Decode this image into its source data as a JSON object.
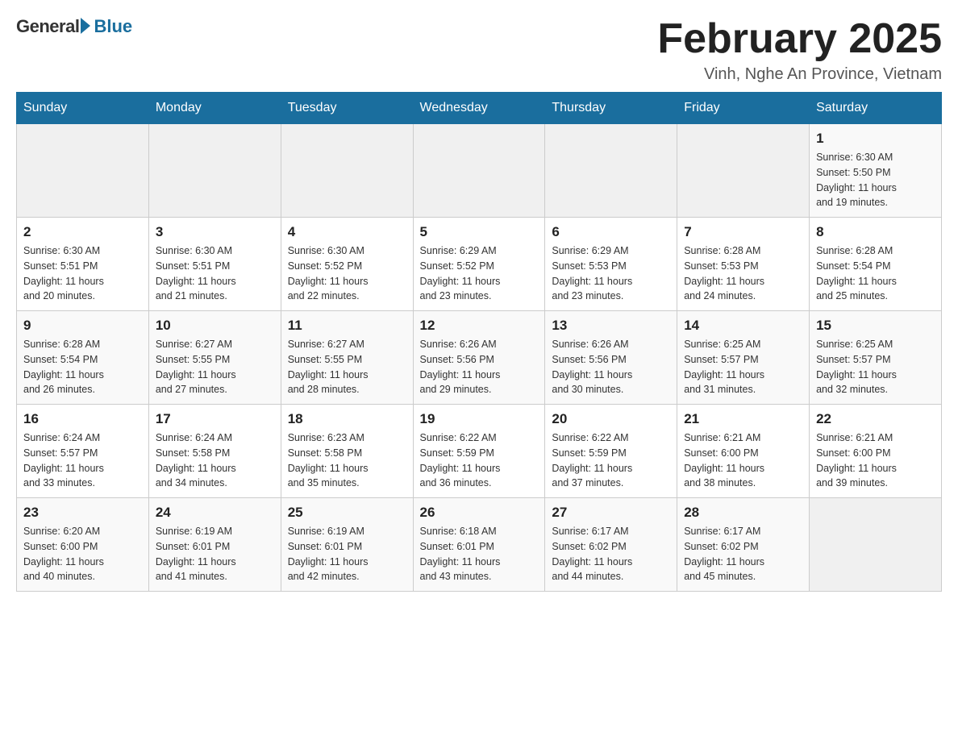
{
  "logo": {
    "general": "General",
    "blue": "Blue",
    "subtitle": ""
  },
  "header": {
    "title": "February 2025",
    "location": "Vinh, Nghe An Province, Vietnam"
  },
  "days_of_week": [
    "Sunday",
    "Monday",
    "Tuesday",
    "Wednesday",
    "Thursday",
    "Friday",
    "Saturday"
  ],
  "weeks": [
    [
      {
        "day": "",
        "info": ""
      },
      {
        "day": "",
        "info": ""
      },
      {
        "day": "",
        "info": ""
      },
      {
        "day": "",
        "info": ""
      },
      {
        "day": "",
        "info": ""
      },
      {
        "day": "",
        "info": ""
      },
      {
        "day": "1",
        "info": "Sunrise: 6:30 AM\nSunset: 5:50 PM\nDaylight: 11 hours\nand 19 minutes."
      }
    ],
    [
      {
        "day": "2",
        "info": "Sunrise: 6:30 AM\nSunset: 5:51 PM\nDaylight: 11 hours\nand 20 minutes."
      },
      {
        "day": "3",
        "info": "Sunrise: 6:30 AM\nSunset: 5:51 PM\nDaylight: 11 hours\nand 21 minutes."
      },
      {
        "day": "4",
        "info": "Sunrise: 6:30 AM\nSunset: 5:52 PM\nDaylight: 11 hours\nand 22 minutes."
      },
      {
        "day": "5",
        "info": "Sunrise: 6:29 AM\nSunset: 5:52 PM\nDaylight: 11 hours\nand 23 minutes."
      },
      {
        "day": "6",
        "info": "Sunrise: 6:29 AM\nSunset: 5:53 PM\nDaylight: 11 hours\nand 23 minutes."
      },
      {
        "day": "7",
        "info": "Sunrise: 6:28 AM\nSunset: 5:53 PM\nDaylight: 11 hours\nand 24 minutes."
      },
      {
        "day": "8",
        "info": "Sunrise: 6:28 AM\nSunset: 5:54 PM\nDaylight: 11 hours\nand 25 minutes."
      }
    ],
    [
      {
        "day": "9",
        "info": "Sunrise: 6:28 AM\nSunset: 5:54 PM\nDaylight: 11 hours\nand 26 minutes."
      },
      {
        "day": "10",
        "info": "Sunrise: 6:27 AM\nSunset: 5:55 PM\nDaylight: 11 hours\nand 27 minutes."
      },
      {
        "day": "11",
        "info": "Sunrise: 6:27 AM\nSunset: 5:55 PM\nDaylight: 11 hours\nand 28 minutes."
      },
      {
        "day": "12",
        "info": "Sunrise: 6:26 AM\nSunset: 5:56 PM\nDaylight: 11 hours\nand 29 minutes."
      },
      {
        "day": "13",
        "info": "Sunrise: 6:26 AM\nSunset: 5:56 PM\nDaylight: 11 hours\nand 30 minutes."
      },
      {
        "day": "14",
        "info": "Sunrise: 6:25 AM\nSunset: 5:57 PM\nDaylight: 11 hours\nand 31 minutes."
      },
      {
        "day": "15",
        "info": "Sunrise: 6:25 AM\nSunset: 5:57 PM\nDaylight: 11 hours\nand 32 minutes."
      }
    ],
    [
      {
        "day": "16",
        "info": "Sunrise: 6:24 AM\nSunset: 5:57 PM\nDaylight: 11 hours\nand 33 minutes."
      },
      {
        "day": "17",
        "info": "Sunrise: 6:24 AM\nSunset: 5:58 PM\nDaylight: 11 hours\nand 34 minutes."
      },
      {
        "day": "18",
        "info": "Sunrise: 6:23 AM\nSunset: 5:58 PM\nDaylight: 11 hours\nand 35 minutes."
      },
      {
        "day": "19",
        "info": "Sunrise: 6:22 AM\nSunset: 5:59 PM\nDaylight: 11 hours\nand 36 minutes."
      },
      {
        "day": "20",
        "info": "Sunrise: 6:22 AM\nSunset: 5:59 PM\nDaylight: 11 hours\nand 37 minutes."
      },
      {
        "day": "21",
        "info": "Sunrise: 6:21 AM\nSunset: 6:00 PM\nDaylight: 11 hours\nand 38 minutes."
      },
      {
        "day": "22",
        "info": "Sunrise: 6:21 AM\nSunset: 6:00 PM\nDaylight: 11 hours\nand 39 minutes."
      }
    ],
    [
      {
        "day": "23",
        "info": "Sunrise: 6:20 AM\nSunset: 6:00 PM\nDaylight: 11 hours\nand 40 minutes."
      },
      {
        "day": "24",
        "info": "Sunrise: 6:19 AM\nSunset: 6:01 PM\nDaylight: 11 hours\nand 41 minutes."
      },
      {
        "day": "25",
        "info": "Sunrise: 6:19 AM\nSunset: 6:01 PM\nDaylight: 11 hours\nand 42 minutes."
      },
      {
        "day": "26",
        "info": "Sunrise: 6:18 AM\nSunset: 6:01 PM\nDaylight: 11 hours\nand 43 minutes."
      },
      {
        "day": "27",
        "info": "Sunrise: 6:17 AM\nSunset: 6:02 PM\nDaylight: 11 hours\nand 44 minutes."
      },
      {
        "day": "28",
        "info": "Sunrise: 6:17 AM\nSunset: 6:02 PM\nDaylight: 11 hours\nand 45 minutes."
      },
      {
        "day": "",
        "info": ""
      }
    ]
  ]
}
